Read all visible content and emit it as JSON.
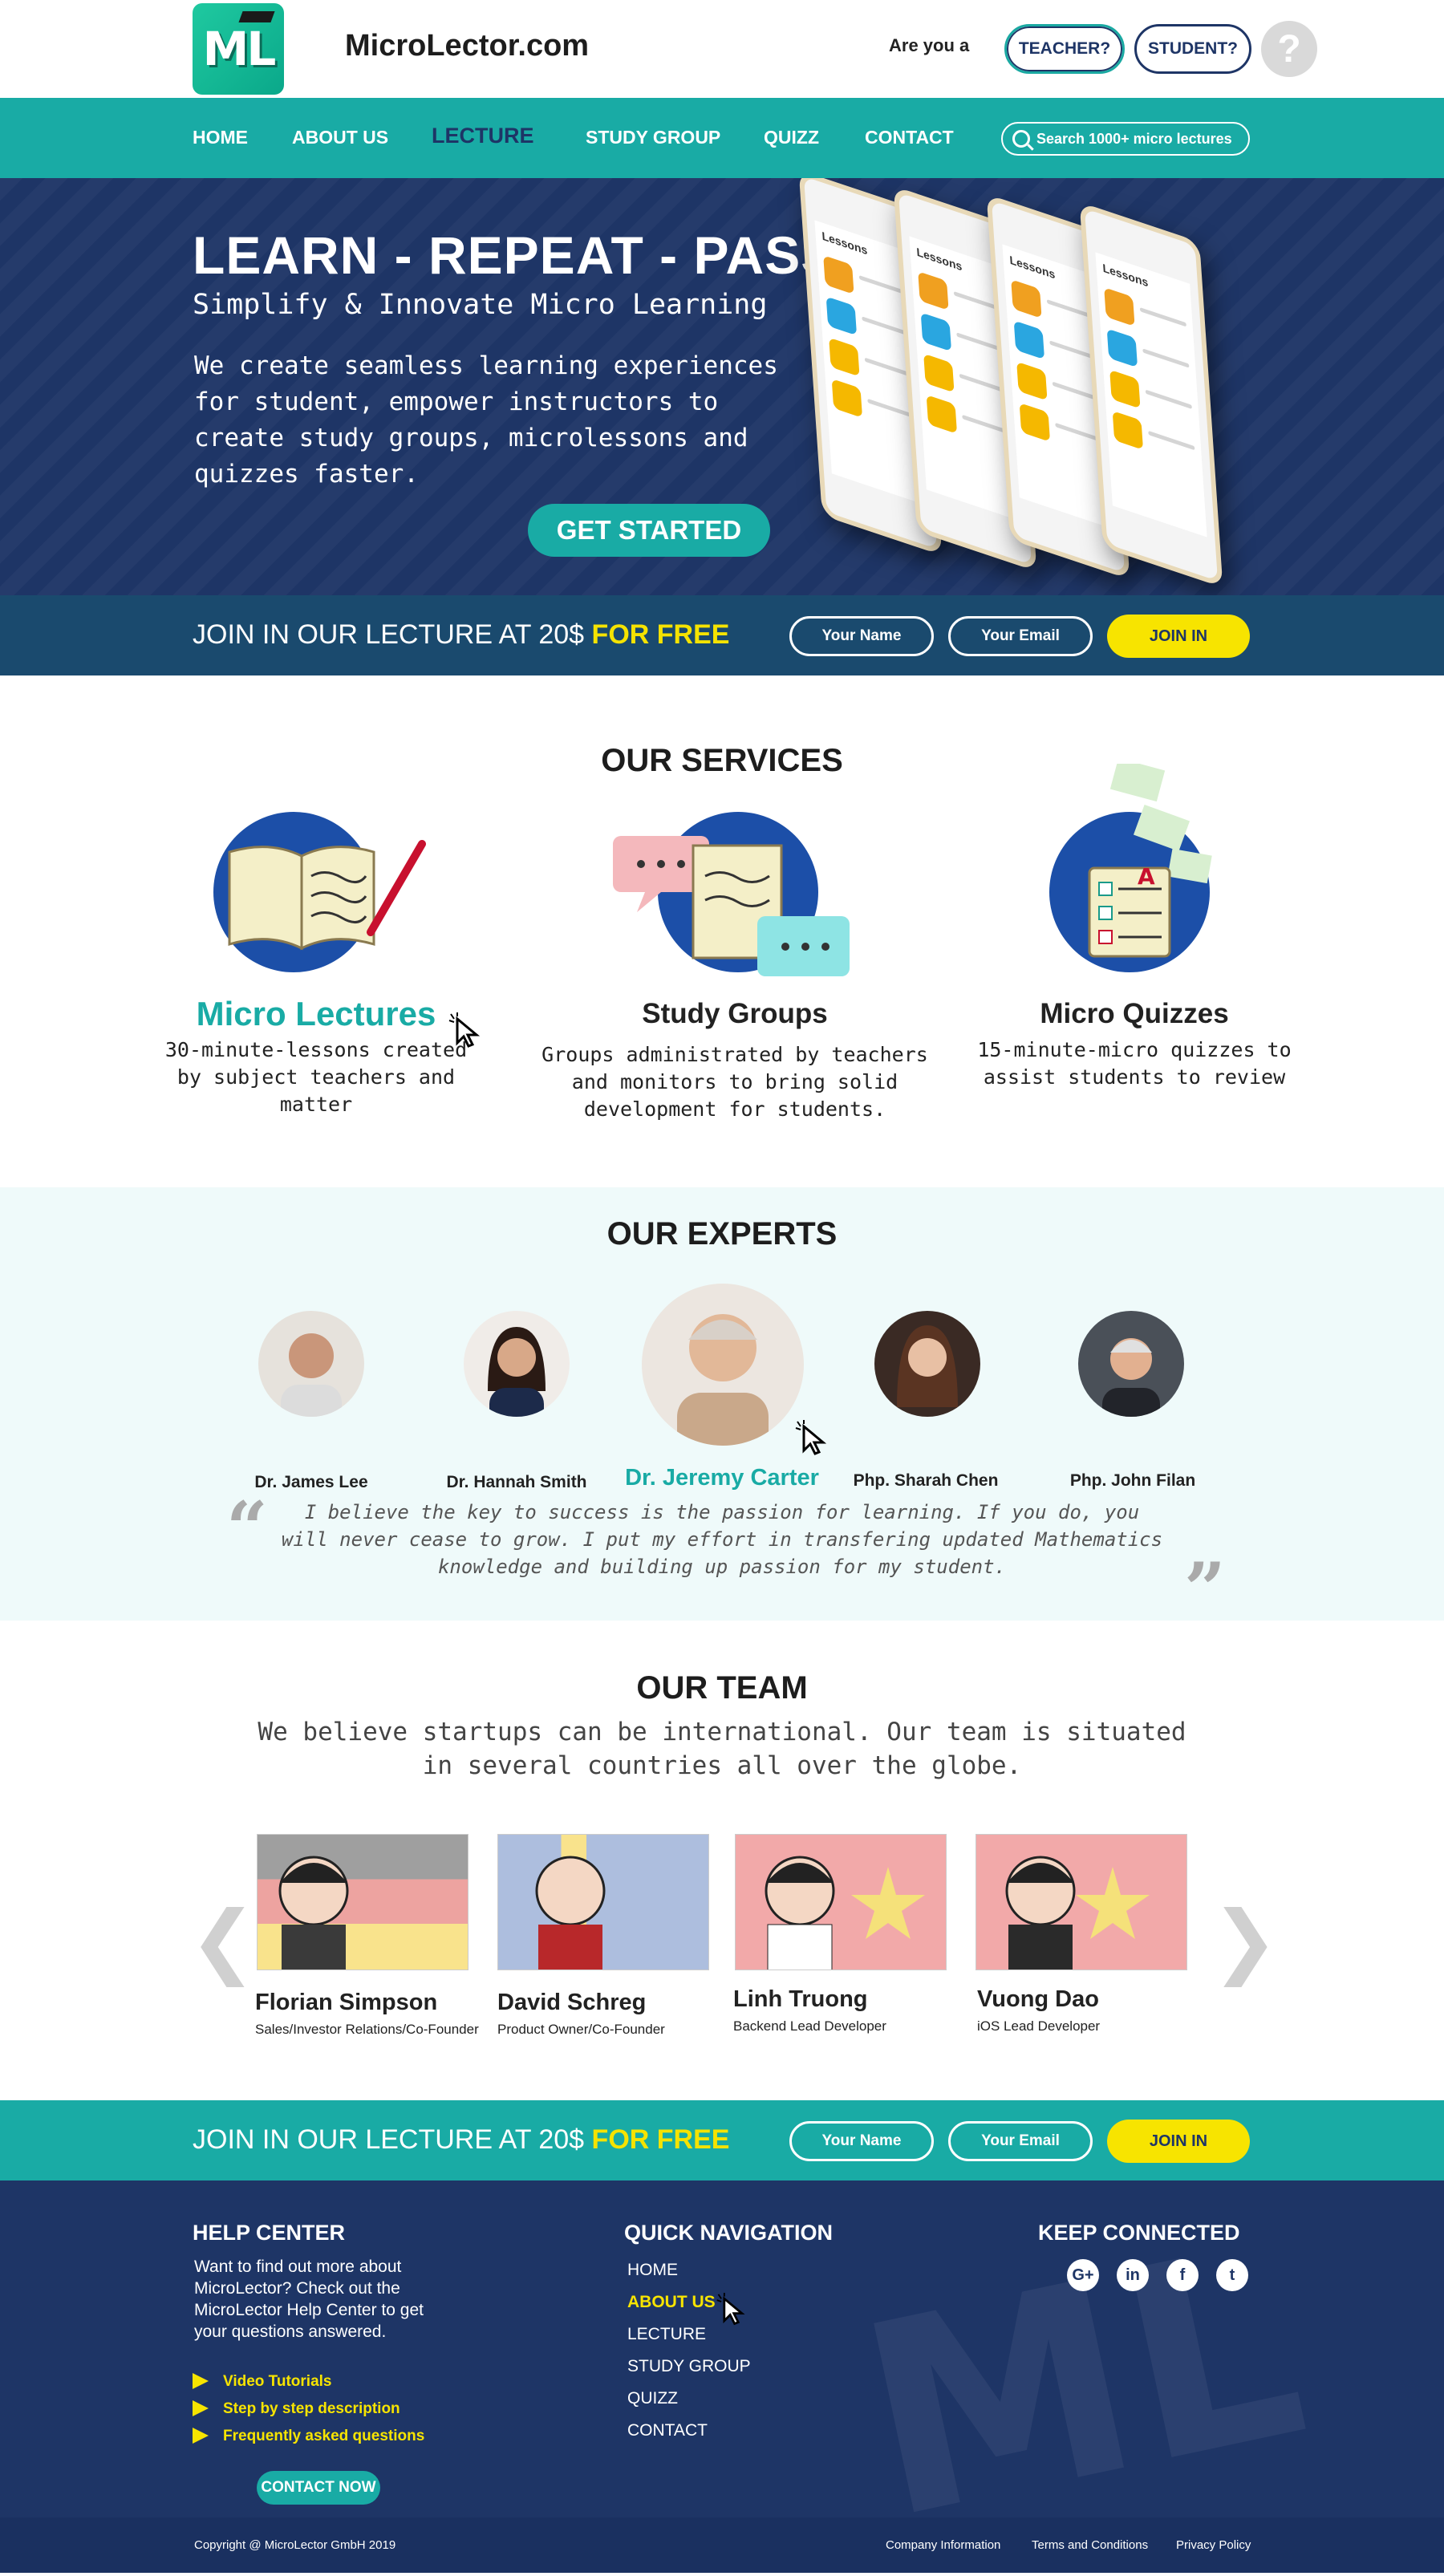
{
  "header": {
    "logo_text": "ML",
    "site_name": "MicroLector.com",
    "are_you": "Are you a",
    "teacher_label": "TEACHER?",
    "student_label": "STUDENT?",
    "help_label": "?"
  },
  "nav": {
    "items": [
      "HOME",
      "ABOUT US",
      "LECTURE",
      "STUDY GROUP",
      "QUIZZ",
      "CONTACT"
    ],
    "active_index": 2,
    "search_placeholder": "Search 1000+ micro lectures"
  },
  "hero": {
    "title": "LEARN - REPEAT - PASS",
    "subtitle": "Simplify & Innovate Micro Learning",
    "body": "We create seamless learning experiences for student, empower instructors to create study groups, microlessons and quizzes faster.",
    "cta_label": "GET STARTED",
    "phone_label": "Lessons"
  },
  "join": {
    "text": "JOIN IN OUR LECTURE AT 20$",
    "highlight": "FOR FREE",
    "name_placeholder": "Your Name",
    "email_placeholder": "Your Email",
    "button_label": "JOIN IN"
  },
  "services": {
    "title": "OUR SERVICES",
    "items": [
      {
        "name": "Micro Lectures",
        "desc": "30-minute-lessons created by subject teachers and matter"
      },
      {
        "name": "Study Groups",
        "desc": "Groups administrated by teachers and monitors to bring solid development for students."
      },
      {
        "name": "Micro Quizzes",
        "desc": "15-minute-micro quizzes to assist students to review"
      }
    ]
  },
  "experts": {
    "title": "OUR EXPERTS",
    "items": [
      "Dr. James Lee",
      "Dr. Hannah Smith",
      "Dr. Jeremy Carter",
      "Php. Sharah Chen",
      "Php. John Filan"
    ],
    "active_index": 2,
    "quote": "I believe the key to success is the passion for learning. If you do, you will never cease to grow. I put my effort in transfering updated Mathematics knowledge and building up passion for my student."
  },
  "team": {
    "title": "OUR TEAM",
    "subtitle": "We believe startups can be international. Our team is situated in several countries all over the globe.",
    "members": [
      {
        "name": "Florian Simpson",
        "role": "Sales/Investor Relations/Co-Founder"
      },
      {
        "name": "David Schreg",
        "role": "Product Owner/Co-Founder"
      },
      {
        "name": "Linh Truong",
        "role": "Backend Lead Developer"
      },
      {
        "name": "Vuong Dao",
        "role": "iOS Lead Developer"
      }
    ],
    "prev_label": "❮",
    "next_label": "❯"
  },
  "footer": {
    "help_title": "HELP CENTER",
    "help_text": "Want to find out more about MicroLector? Check out the MicroLector Help Center to get your questions answered.",
    "help_links": [
      "Video Tutorials",
      "Step by step description",
      "Frequently asked questions"
    ],
    "contact_label": "CONTACT NOW",
    "nav_title": "QUICK NAVIGATION",
    "nav_items": [
      "HOME",
      "ABOUT US",
      "LECTURE",
      "STUDY GROUP",
      "QUIZZ",
      "CONTACT"
    ],
    "nav_active_index": 1,
    "social_title": "KEEP CONNECTED",
    "social": [
      {
        "name": "google-plus-icon",
        "glyph": "G+"
      },
      {
        "name": "linkedin-icon",
        "glyph": "in"
      },
      {
        "name": "facebook-icon",
        "glyph": "f"
      },
      {
        "name": "twitter-icon",
        "glyph": "t"
      }
    ],
    "watermark": "ML"
  },
  "bottom": {
    "copyright": "Copyright @ MicroLector GmbH 2019",
    "links": [
      "Company Information",
      "Terms and Conditions",
      "Privacy Policy"
    ]
  },
  "colors": {
    "navy": "#1e3566",
    "teal": "#19aba5",
    "yellow": "#f7e400",
    "light_teal_bg": "#effafa"
  }
}
